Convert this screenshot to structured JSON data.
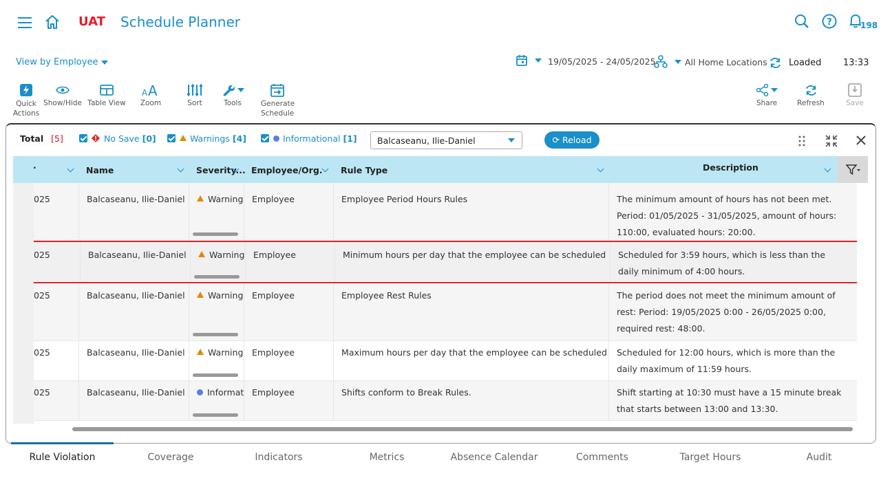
{
  "header": {
    "env": "UAT",
    "title": "Schedule Planner",
    "notification_count": "198"
  },
  "toolbar_top": {
    "view_by": "View by Employee",
    "date_range": "19/05/2025 - 24/05/2025",
    "locations": "All Home Locations",
    "status": "Loaded",
    "time": "13:33"
  },
  "toolbar": {
    "quick_actions": "Quick Actions",
    "show_hide": "Show/Hide",
    "table_view": "Table View",
    "zoom": "Zoom",
    "sort": "Sort",
    "tools": "Tools",
    "generate_schedule": "Generate Schedule",
    "share": "Share",
    "refresh": "Refresh",
    "save": "Save"
  },
  "filters": {
    "total_label": "Total",
    "total_count": "[5]",
    "no_save_label": "No Save",
    "no_save_count": "[0]",
    "warnings_label": "Warnings",
    "warnings_count": "[4]",
    "info_label": "Informational",
    "info_count": "[1]",
    "employee": "Balcaseanu, Ilie-Daniel",
    "reload": "Reload"
  },
  "columns": {
    "name": "Name",
    "severity": "Severity...",
    "employee_org": "Employee/Org.",
    "rule_type": "Rule Type",
    "description": "Description"
  },
  "rows": [
    {
      "date": "025",
      "name": "Balcaseanu, Ilie-Daniel",
      "severity": "Warning",
      "org": "Employee",
      "rule": "Employee Period Hours Rules",
      "desc": "The minimum amount of hours has not been met. Period: 01/05/2025 - 31/05/2025, amount of hours: 110:00, evaluated hours: 20:00."
    },
    {
      "date": "025",
      "name": "Balcaseanu, Ilie-Daniel",
      "severity": "Warning",
      "org": "Employee",
      "rule": "Minimum hours per day that the employee can be scheduled",
      "desc": "Scheduled for 3:59 hours, which is less than the daily minimum of 4:00 hours."
    },
    {
      "date": "025",
      "name": "Balcaseanu, Ilie-Daniel",
      "severity": "Warning",
      "org": "Employee",
      "rule": "Employee Rest Rules",
      "desc": "The period does not meet the minimum amount of rest: Period: 19/05/2025 0:00 - 26/05/2025 0:00, required rest: 48:00."
    },
    {
      "date": "025",
      "name": "Balcaseanu, Ilie-Daniel",
      "severity": "Warning",
      "org": "Employee",
      "rule": "Maximum hours per day that the employee can be scheduled",
      "desc": "Scheduled for 12:00 hours, which is more than the daily maximum of 11:59 hours."
    },
    {
      "date": "025",
      "name": "Balcaseanu, Ilie-Daniel",
      "severity": "Informati",
      "org": "Employee",
      "rule": "Shifts conform to Break Rules.",
      "desc": "Shift starting at 10:30 must have a 15 minute break that starts between 13:00 and 13:30."
    }
  ],
  "tabs": [
    "Rule Violation",
    "Coverage",
    "Indicators",
    "Metrics",
    "Absence Calendar",
    "Comments",
    "Target Hours",
    "Audit"
  ],
  "colors": {
    "accent": "#1a8fc9",
    "env": "#e4202a",
    "warning": "#e08a00",
    "selected_border": "#d9262c"
  }
}
